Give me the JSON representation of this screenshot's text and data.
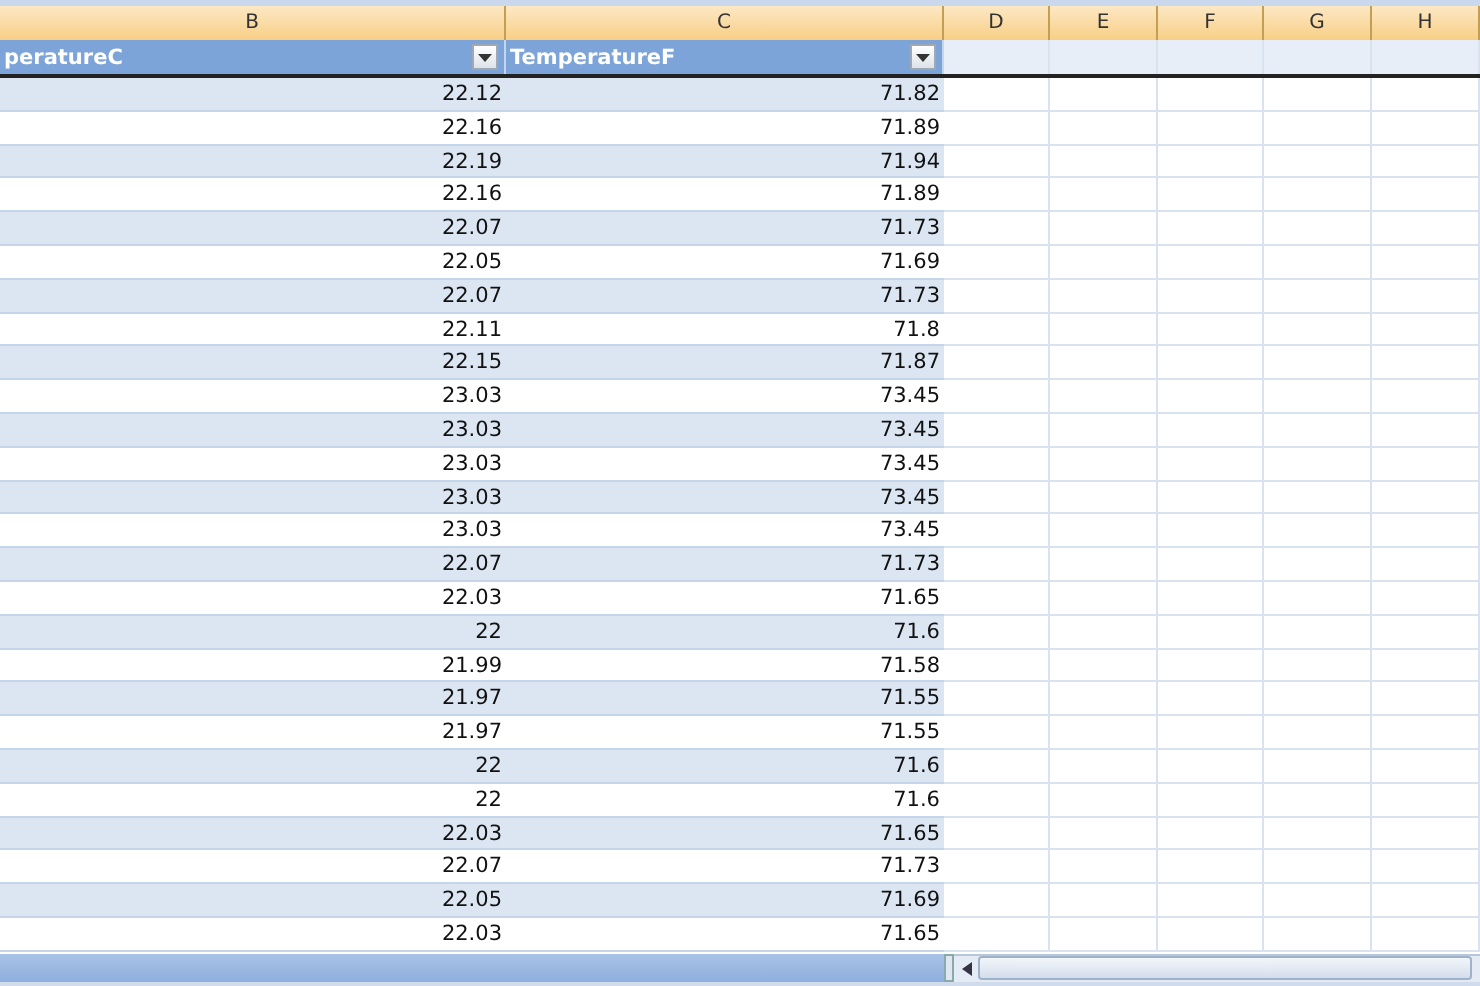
{
  "column_headers": [
    {
      "label": "B",
      "selected": false
    },
    {
      "label": "C",
      "selected": false
    },
    {
      "label": "D",
      "selected": false
    },
    {
      "label": "E",
      "selected": false
    },
    {
      "label": "F",
      "selected": false
    },
    {
      "label": "G",
      "selected": false
    },
    {
      "label": "H",
      "selected": false
    }
  ],
  "table": {
    "columns": [
      "peratureC",
      "TemperatureF"
    ],
    "rows": [
      [
        "22.12",
        "71.82"
      ],
      [
        "22.16",
        "71.89"
      ],
      [
        "22.19",
        "71.94"
      ],
      [
        "22.16",
        "71.89"
      ],
      [
        "22.07",
        "71.73"
      ],
      [
        "22.05",
        "71.69"
      ],
      [
        "22.07",
        "71.73"
      ],
      [
        "22.11",
        "71.8"
      ],
      [
        "22.15",
        "71.87"
      ],
      [
        "23.03",
        "73.45"
      ],
      [
        "23.03",
        "73.45"
      ],
      [
        "23.03",
        "73.45"
      ],
      [
        "23.03",
        "73.45"
      ],
      [
        "23.03",
        "73.45"
      ],
      [
        "22.07",
        "71.73"
      ],
      [
        "22.03",
        "71.65"
      ],
      [
        "22",
        "71.6"
      ],
      [
        "21.99",
        "71.58"
      ],
      [
        "21.97",
        "71.55"
      ],
      [
        "21.97",
        "71.55"
      ],
      [
        "22",
        "71.6"
      ],
      [
        "22",
        "71.6"
      ],
      [
        "22.03",
        "71.65"
      ],
      [
        "22.07",
        "71.73"
      ],
      [
        "22.05",
        "71.69"
      ],
      [
        "22.03",
        "71.65"
      ]
    ]
  }
}
